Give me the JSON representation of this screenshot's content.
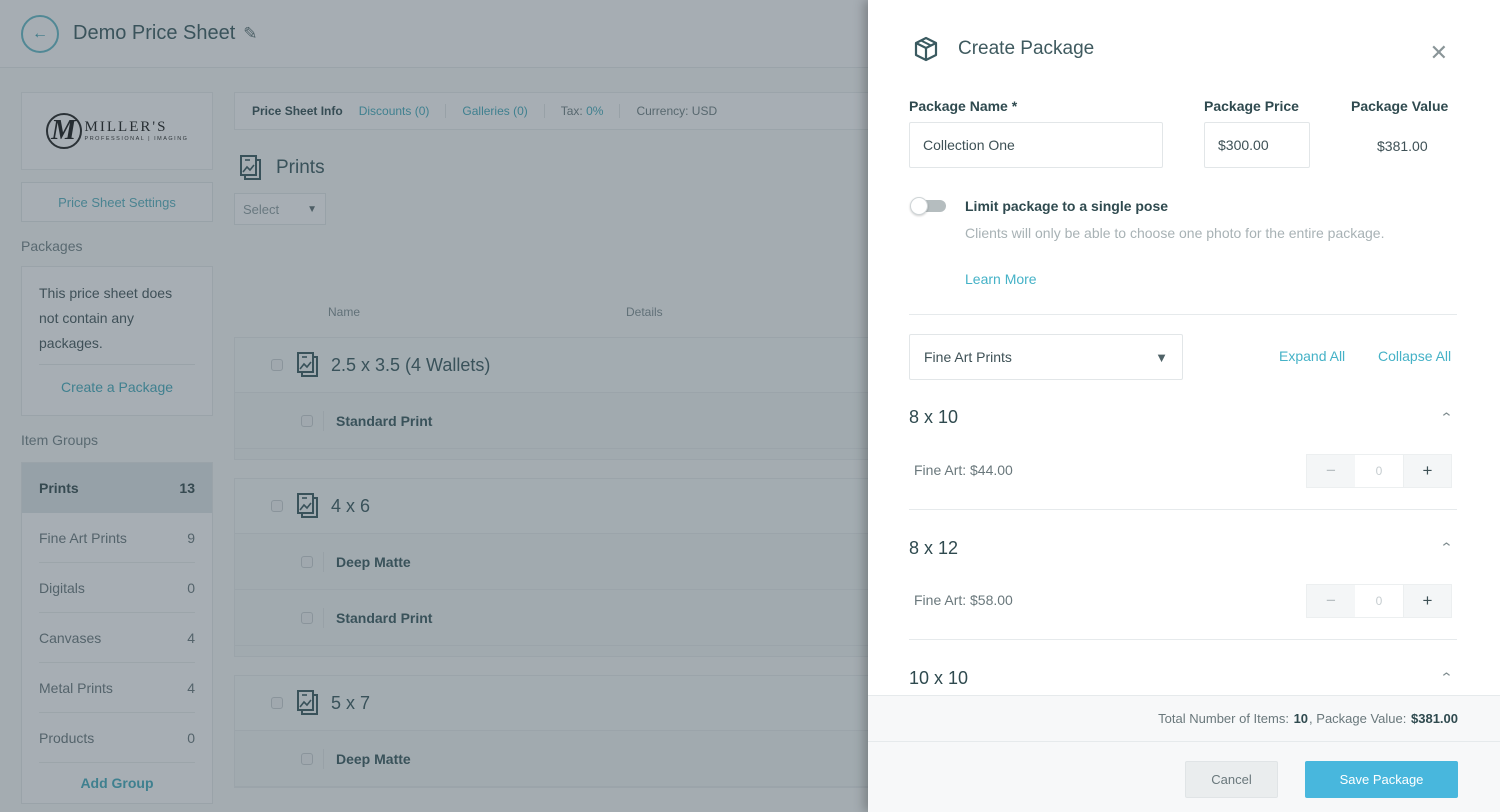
{
  "header": {
    "title": "Demo Price Sheet",
    "back_icon": "arrow-left-icon",
    "edit_icon": "pencil-icon"
  },
  "sidebar": {
    "logo": {
      "main": "MILLER'S",
      "sub": "PROFESSIONAL | IMAGING",
      "monogram": "M"
    },
    "settings_label": "Price Sheet Settings",
    "packages_label": "Packages",
    "packages_empty_text": "This price sheet does not contain any packages.",
    "create_package_label": "Create a Package",
    "item_groups_label": "Item Groups",
    "groups": [
      {
        "label": "Prints",
        "count": "13",
        "active": true
      },
      {
        "label": "Fine Art Prints",
        "count": "9"
      },
      {
        "label": "Digitals",
        "count": "0"
      },
      {
        "label": "Canvases",
        "count": "4"
      },
      {
        "label": "Metal Prints",
        "count": "4"
      },
      {
        "label": "Products",
        "count": "0"
      }
    ],
    "add_group_label": "Add Group"
  },
  "info_bar": {
    "price_sheet_info": "Price Sheet Info",
    "discounts": "Discounts (0)",
    "galleries": "Galleries (0)",
    "tax_label": "Tax:",
    "tax_value": "0%",
    "currency": "Currency: USD"
  },
  "content": {
    "section_title": "Prints",
    "select_placeholder": "Select",
    "columns": {
      "name": "Name",
      "details": "Details"
    },
    "items": [
      {
        "title": "2.5 x 3.5 (4 Wallets)",
        "variants": [
          "Standard Print"
        ]
      },
      {
        "title": "4 x 6",
        "variants": [
          "Deep Matte",
          "Standard Print"
        ]
      },
      {
        "title": "5 x 7",
        "variants": [
          "Deep Matte"
        ]
      }
    ]
  },
  "modal": {
    "title": "Create Package",
    "icon": "package-box-icon",
    "close_icon": "close-icon",
    "package_name_label": "Package Name *",
    "package_name_value": "Collection One",
    "package_price_label": "Package Price",
    "package_price_value": "$300.00",
    "package_value_label": "Package Value",
    "package_value": "$381.00",
    "toggle_label": "Limit package to a single pose",
    "toggle_on": false,
    "toggle_help": "Clients will only be able to choose one photo for the entire package.",
    "learn_more": "Learn More",
    "group_select_value": "Fine Art Prints",
    "expand_all": "Expand All",
    "collapse_all": "Collapse All",
    "sizes": [
      {
        "title": "8 x 10",
        "price_line": "Fine Art: $44.00",
        "quantity": "0"
      },
      {
        "title": "8 x 12",
        "price_line": "Fine Art: $58.00",
        "quantity": "0"
      },
      {
        "title": "10 x 10"
      }
    ],
    "totals": {
      "items_label": "Total Number of Items:",
      "items_value": "10",
      "value_label": ", Package Value:",
      "value": "$381.00"
    },
    "cancel_label": "Cancel",
    "save_label": "Save Package"
  },
  "colors": {
    "accent": "#48b7dd",
    "link": "#45b2c7",
    "text_dark": "#2f4a4f"
  }
}
